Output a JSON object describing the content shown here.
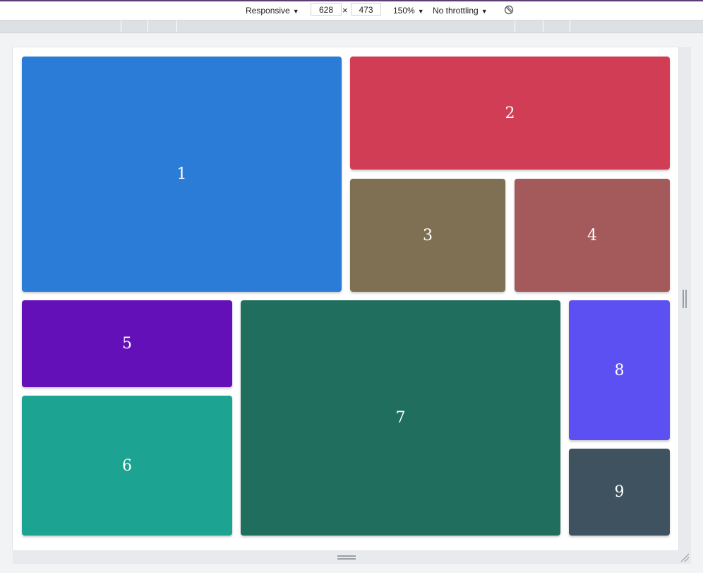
{
  "toolbar": {
    "device_label": "Responsive",
    "width_value": "628",
    "times_symbol": "×",
    "height_value": "473",
    "zoom_label": "150%",
    "throttle_label": "No throttling",
    "dropdown_glyph": "▼",
    "rotate_icon": "rotate-icon"
  },
  "tiles": [
    {
      "label": "1",
      "color": "#2a7cd7"
    },
    {
      "label": "2",
      "color": "#d03d55"
    },
    {
      "label": "3",
      "color": "#7f7054"
    },
    {
      "label": "4",
      "color": "#a45a5a"
    },
    {
      "label": "5",
      "color": "#6410b8"
    },
    {
      "label": "6",
      "color": "#1ca391"
    },
    {
      "label": "7",
      "color": "#1f6e5e"
    },
    {
      "label": "8",
      "color": "#5c50f3"
    },
    {
      "label": "9",
      "color": "#3f5260"
    }
  ]
}
